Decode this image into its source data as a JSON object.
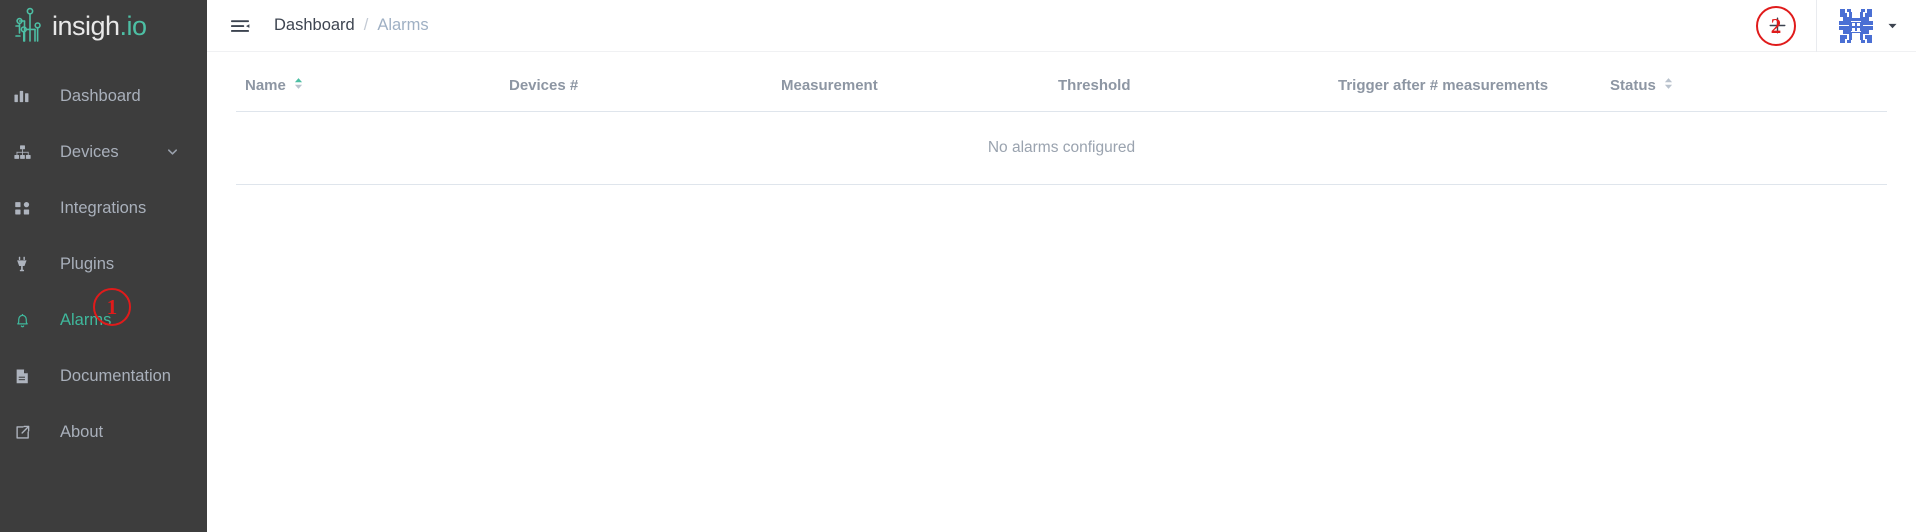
{
  "brand": {
    "name": "insigh",
    "suffix": ".io",
    "logo_icon": "circuit-nodes-icon"
  },
  "sidebar": {
    "items": [
      {
        "label": "Dashboard",
        "icon": "bar-chart-icon",
        "key": "dashboard",
        "active": false,
        "expandable": false
      },
      {
        "label": "Devices",
        "icon": "sitemap-icon",
        "key": "devices",
        "active": false,
        "expandable": true
      },
      {
        "label": "Integrations",
        "icon": "grid-squares-icon",
        "key": "integrations",
        "active": false,
        "expandable": false
      },
      {
        "label": "Plugins",
        "icon": "plug-icon",
        "key": "plugins",
        "active": false,
        "expandable": false
      },
      {
        "label": "Alarms",
        "icon": "bell-icon",
        "key": "alarms",
        "active": true,
        "expandable": false
      },
      {
        "label": "Documentation",
        "icon": "document-icon",
        "key": "documentation",
        "active": false,
        "expandable": false
      },
      {
        "label": "About",
        "icon": "external-link-icon",
        "key": "about",
        "active": false,
        "expandable": false
      }
    ],
    "active_color": "#3fb89c",
    "background": "#3d3d3d"
  },
  "topbar": {
    "collapse_icon": "hamburger-collapse-icon",
    "breadcrumb": {
      "root": "Dashboard",
      "separator": "/",
      "current": "Alarms"
    },
    "add_icon": "plus-icon",
    "avatar_icon": "identicon-avatar",
    "avatar_color": "#4a6fd4",
    "caret_icon": "caret-down-icon"
  },
  "table": {
    "columns": [
      {
        "label": "Name",
        "key": "name",
        "sortable": true,
        "sort": "asc"
      },
      {
        "label": "Devices #",
        "key": "devices",
        "sortable": false,
        "sort": "none"
      },
      {
        "label": "Measurement",
        "key": "measure",
        "sortable": false,
        "sort": "none"
      },
      {
        "label": "Threshold",
        "key": "threshold",
        "sortable": false,
        "sort": "none"
      },
      {
        "label": "Trigger after # measurements",
        "key": "trigger",
        "sortable": false,
        "sort": "none"
      },
      {
        "label": "Status",
        "key": "status",
        "sortable": true,
        "sort": "none"
      }
    ],
    "rows": [],
    "empty_message": "No alarms configured"
  },
  "annotations": [
    {
      "id": "1",
      "label": "1",
      "target": "sidebar-item-alarms",
      "color": "#e01b1b"
    },
    {
      "id": "2",
      "label": "2",
      "target": "add-alarm-button",
      "color": "#e01b1b"
    }
  ]
}
